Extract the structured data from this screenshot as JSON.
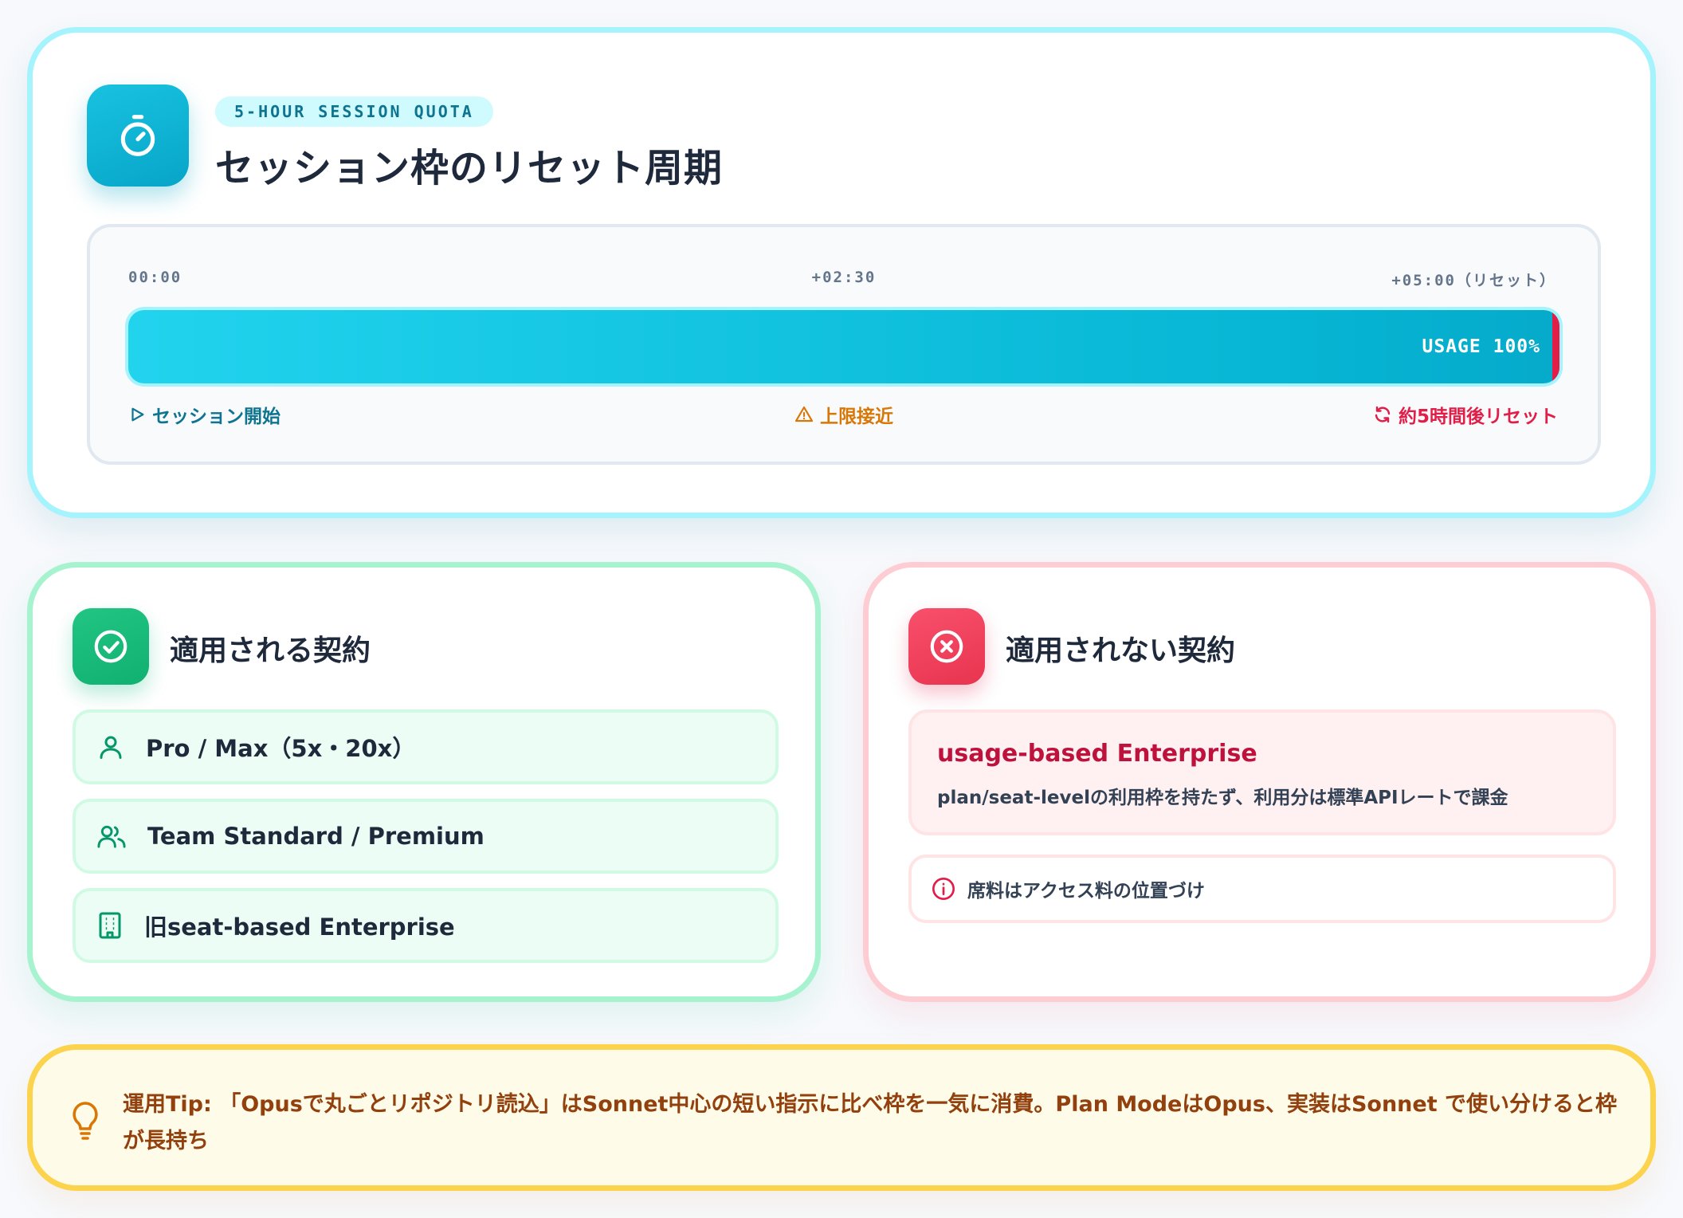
{
  "quota": {
    "eyebrow": "5-HOUR SESSION QUOTA",
    "title": "セッション枠のリセット周期",
    "timeline": {
      "tick_start": "00:00",
      "tick_mid": "+02:30",
      "tick_end": "+05:00（リセット）",
      "usage_label": "USAGE",
      "usage_value": "100%",
      "usage_fraction": 1.0,
      "marker_start": "セッション開始",
      "marker_mid": "上限接近",
      "marker_end": "約5時間後リセット"
    },
    "icons": {
      "badge": "stopwatch-icon",
      "start": "play-icon",
      "mid": "warning-icon",
      "end": "refresh-icon"
    }
  },
  "applied": {
    "title": "適用される契約",
    "icon": "check-circle-icon",
    "items": [
      {
        "label": "Pro / Max（5x・20x）",
        "icon": "user-icon"
      },
      {
        "label": "Team Standard / Premium",
        "icon": "users-icon"
      },
      {
        "label": "旧seat-based Enterprise",
        "icon": "building-icon"
      }
    ]
  },
  "excluded": {
    "title": "適用されない契約",
    "icon": "x-circle-icon",
    "plan_name": "usage-based Enterprise",
    "plan_desc": "plan/seat-levelの利用枠を持たず、利用分は標準APIレートで課金",
    "note": "席料はアクセス料の位置づけ",
    "note_icon": "info-icon"
  },
  "tip": {
    "lead": "運用Tip:",
    "text": "「Opusで丸ごとリポジトリ読込」はSonnet中心の短い指示に比べ枠を一気に消費。Plan ModeはOpus、実装はSonnet で使い分けると枠が長持ち",
    "icon": "lightbulb-icon"
  },
  "colors": {
    "cyan": "#06b6d4",
    "green": "#10b981",
    "rose": "#e11d48",
    "amber": "#d97706"
  }
}
